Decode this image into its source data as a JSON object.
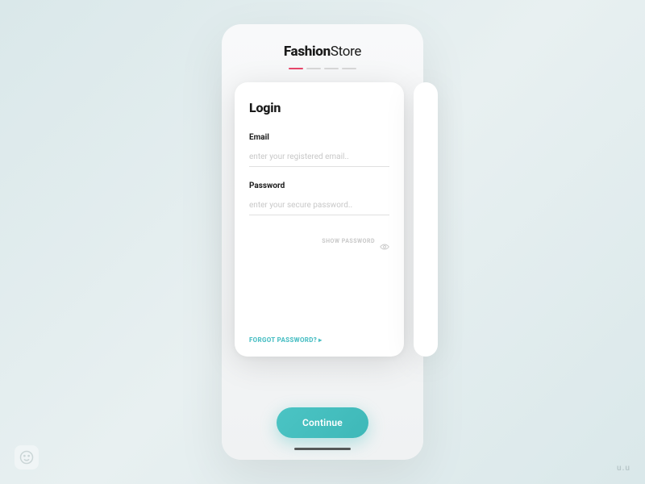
{
  "logo": {
    "bold": "Fashion",
    "light": "Store"
  },
  "steps": {
    "count": 4,
    "active": 0
  },
  "card": {
    "title": "Login",
    "email": {
      "label": "Email",
      "placeholder": "enter your registered email.."
    },
    "password": {
      "label": "Password",
      "placeholder": "enter your secure password.."
    },
    "showPassword": "SHOW PASSWORD",
    "forgot": "FORGOT PASSWORD?"
  },
  "continueButton": "Continue",
  "watermark": "u.u"
}
